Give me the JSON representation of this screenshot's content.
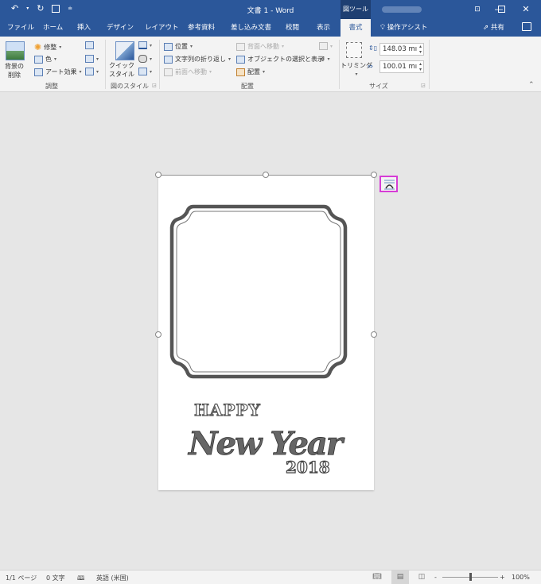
{
  "window": {
    "title": "文書 1  -  Word",
    "context_tool": "図ツール",
    "user_name_blurred": "",
    "controls": {
      "ribbon_display": "⊡",
      "minimize": "—",
      "maximize": "☐",
      "close": "✕"
    }
  },
  "qat": {
    "undo": "↶",
    "undo_arrow": "▾",
    "redo": "↻",
    "save": "🖫",
    "customize": "⩧"
  },
  "tabs": [
    {
      "label": "ファイル"
    },
    {
      "label": "ホーム"
    },
    {
      "label": "挿入"
    },
    {
      "label": "デザイン"
    },
    {
      "label": "レイアウト"
    },
    {
      "label": "参考資料"
    },
    {
      "label": "差し込み文書"
    },
    {
      "label": "校閲"
    },
    {
      "label": "表示"
    },
    {
      "label": "書式",
      "active": true
    }
  ],
  "tell_me": "操作アシスト",
  "share": "共有",
  "ribbon": {
    "adjust": {
      "label": "調整",
      "remove_bg_line1": "背景の",
      "remove_bg_line2": "削除",
      "corrections": "修整",
      "color": "色",
      "artistic": "アート効果"
    },
    "picture_styles": {
      "label": "図のスタイル",
      "quick_line1": "クイック",
      "quick_line2": "スタイル"
    },
    "arrange": {
      "label": "配置",
      "position": "位置",
      "wrap_text": "文字列の折り返し",
      "bring_forward": "前面へ移動",
      "send_backward": "背面へ移動",
      "selection_pane": "オブジェクトの選択と表示",
      "align": "配置"
    },
    "size": {
      "label": "サイズ",
      "crop": "トリミング",
      "height": "148.03 mı",
      "width": "100.01 mı"
    }
  },
  "document": {
    "image_text_line1": "HAPPY",
    "image_text_line2": "New Year",
    "image_text_line3": "2018"
  },
  "status": {
    "page": "1/1 ページ",
    "words": "0 文字",
    "language": "英語 (米国)",
    "zoom": "100%",
    "zoom_minus": "-",
    "zoom_plus": "+",
    "zoom_level_fraction": 0.5
  },
  "colors": {
    "brand": "#2b579a",
    "highlight": "#d63cd6"
  }
}
